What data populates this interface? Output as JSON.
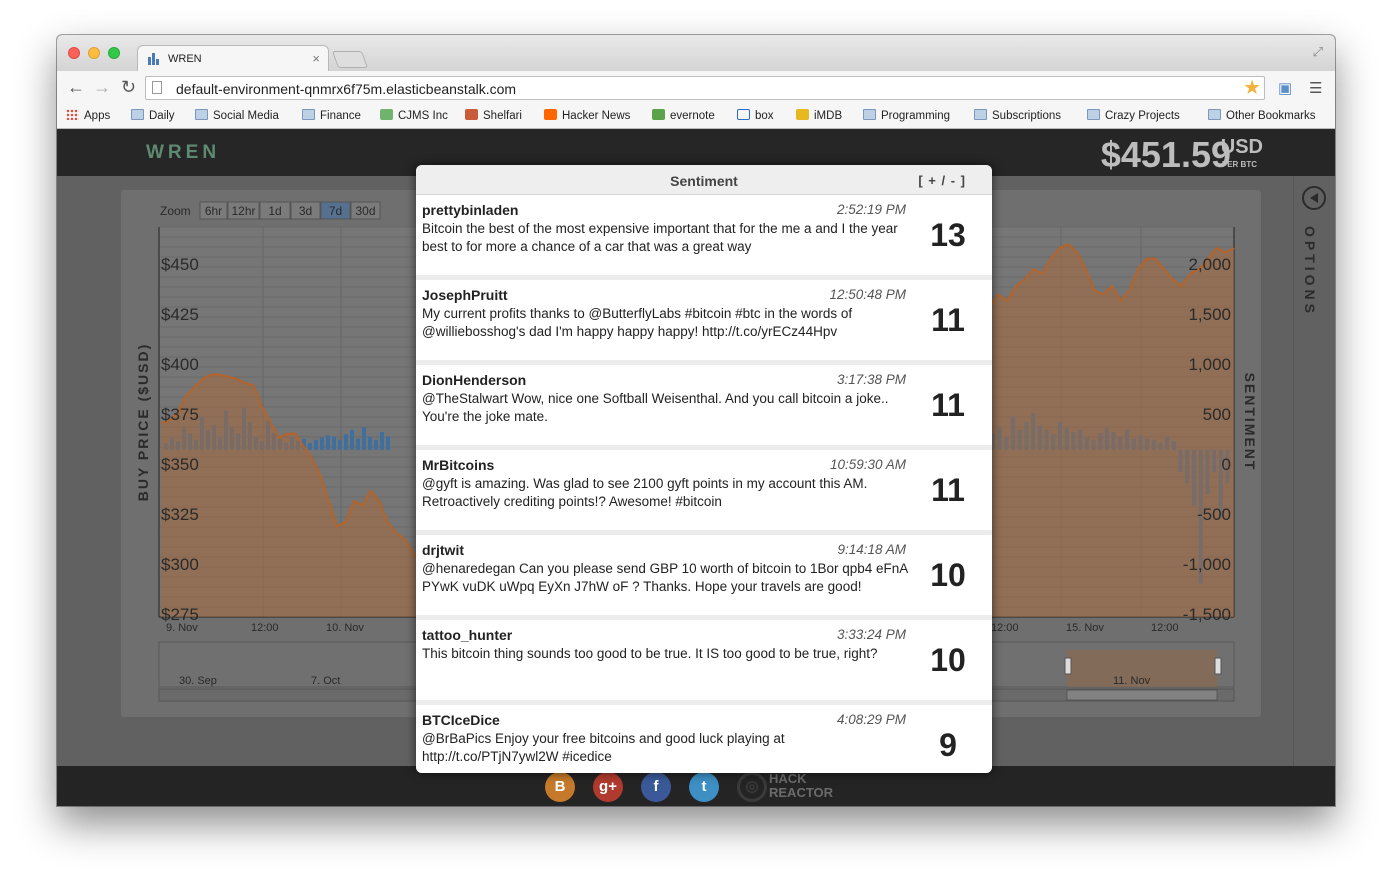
{
  "browser": {
    "tab_title": "WREN",
    "tab_close": "×",
    "url": "default-environment-qnmrx6f75m.elasticbeanstalk.com",
    "bookmarks": [
      {
        "label": "Apps",
        "icon": "apps-grid-icon"
      },
      {
        "label": "Daily",
        "icon": "folder-icon"
      },
      {
        "label": "Social Media",
        "icon": "folder-icon"
      },
      {
        "label": "Finance",
        "icon": "folder-icon"
      },
      {
        "label": "CJMS Inc",
        "icon": "cjms-icon"
      },
      {
        "label": "Shelfari",
        "icon": "shelfari-icon"
      },
      {
        "label": "Hacker News",
        "icon": "hacker-news-icon"
      },
      {
        "label": "evernote",
        "icon": "evernote-icon"
      },
      {
        "label": "box",
        "icon": "box-icon"
      },
      {
        "label": "iMDB",
        "icon": "imdb-icon"
      },
      {
        "label": "Programming",
        "icon": "folder-icon"
      },
      {
        "label": "Subscriptions",
        "icon": "folder-icon"
      },
      {
        "label": "Crazy Projects",
        "icon": "folder-icon"
      },
      {
        "label": "Other Bookmarks",
        "icon": "folder-icon"
      }
    ]
  },
  "app": {
    "logo": "WREN",
    "price": "$451.59",
    "price_unit": "USD",
    "price_sub": "PER BTC",
    "options_label": "OPTIONS",
    "footer_brand": "HACK REACTOR"
  },
  "chart_data": {
    "type": "line",
    "zoom_label": "Zoom",
    "zoom_options": [
      "6hr",
      "12hr",
      "1d",
      "3d",
      "7d",
      "30d"
    ],
    "zoom_selected": "7d",
    "ylabel": "BUY PRICE ($USD)",
    "y2label": "SENTIMENT",
    "y_ticks": [
      "$450",
      "$425",
      "$400",
      "$375",
      "$350",
      "$325",
      "$300",
      "$275"
    ],
    "y2_ticks": [
      "2,000",
      "1,500",
      "1,000",
      "500",
      "0",
      "-500",
      "-1,000",
      "-1,500"
    ],
    "x_ticks_left": [
      "9. Nov",
      "12:00",
      "10. Nov"
    ],
    "x_ticks_right": [
      "12:00",
      "15. Nov",
      "12:00"
    ],
    "navigator_ticks": [
      "30. Sep",
      "7. Oct",
      "11. Nov"
    ],
    "ylim": [
      275,
      460
    ],
    "y2lim": [
      -1500,
      2000
    ],
    "series": [
      {
        "name": "price",
        "color": "#b4642a",
        "left_values": [
          367,
          368,
          372,
          380,
          384,
          388,
          390,
          390,
          389,
          388,
          386,
          385,
          375,
          368,
          360,
          362,
          362,
          356,
          350,
          342,
          330,
          318,
          320,
          330,
          328,
          335,
          330,
          320,
          315,
          312,
          306,
          300
        ],
        "right_values": [
          420,
          422,
          428,
          425,
          432,
          435,
          440,
          438,
          445,
          450,
          452,
          448,
          440,
          430,
          428,
          432,
          425,
          430,
          440,
          445,
          445,
          440,
          435,
          432,
          438,
          440,
          445,
          450,
          448,
          450
        ]
      },
      {
        "name": "sentiment",
        "color": "#3f6f9e",
        "left_values": [
          60,
          120,
          80,
          200,
          150,
          90,
          300,
          180,
          220,
          120,
          350,
          200,
          150,
          380,
          250,
          120,
          80,
          260,
          150,
          100,
          60,
          120,
          80,
          100,
          60,
          90,
          110,
          130,
          120,
          90,
          140,
          180,
          100,
          200,
          120,
          90,
          160,
          120
        ],
        "right_values": [
          150,
          200,
          120,
          300,
          180,
          250,
          330,
          220,
          180,
          140,
          250,
          200,
          160,
          180,
          120,
          90,
          150,
          200,
          160,
          120,
          180,
          100,
          130,
          100,
          90,
          60,
          120,
          80,
          -200,
          -300,
          -500,
          -1200,
          -400,
          -200,
          -600,
          -300
        ]
      }
    ]
  },
  "sentiment": {
    "title": "Sentiment",
    "toggle": "[ + / - ]",
    "tweets": [
      {
        "user": "prettybinladen",
        "time": "2:52:19 PM",
        "text": "Bitcoin the best of the most expensive important that for the me a and I the year best to for more a chance of a car that was a great way",
        "score": "13"
      },
      {
        "user": "JosephPruitt",
        "time": "12:50:48 PM",
        "text": "My current profits thanks to @ButterflyLabs #bitcoin #btc in the words of @williebosshog's dad I'm happy happy happy! http://t.co/yrECz44Hpv",
        "score": "11"
      },
      {
        "user": "DionHenderson",
        "time": "3:17:38 PM",
        "text": "@TheStalwart Wow, nice one Softball Weisenthal. And you call bitcoin a joke.. You're the joke mate.",
        "score": "11"
      },
      {
        "user": "MrBitcoins",
        "time": "10:59:30 AM",
        "text": "@gyft is amazing. Was glad to see 2100 gyft points in my account this AM. Retroactively crediting points!? Awesome! #bitcoin",
        "score": "11"
      },
      {
        "user": "drjtwit",
        "time": "9:14:18 AM",
        "text": "@henaredegan Can you please send GBP 10 worth of bitcoin to 1Bor qpb4 eFnA PYwK vuDK uWpq EyXn J7hW oF ? Thanks. Hope your travels are good!",
        "score": "10"
      },
      {
        "user": "tattoo_hunter",
        "time": "3:33:24 PM",
        "text": "This bitcoin thing sounds too good to be true. It IS too good to be true, right?",
        "score": "10"
      },
      {
        "user": "BTCIceDice",
        "time": "4:08:29 PM",
        "text": "@BrBaPics Enjoy your free bitcoins and good luck playing at http://t.co/PTjN7ywl2W #icedice",
        "score": "9"
      }
    ]
  }
}
